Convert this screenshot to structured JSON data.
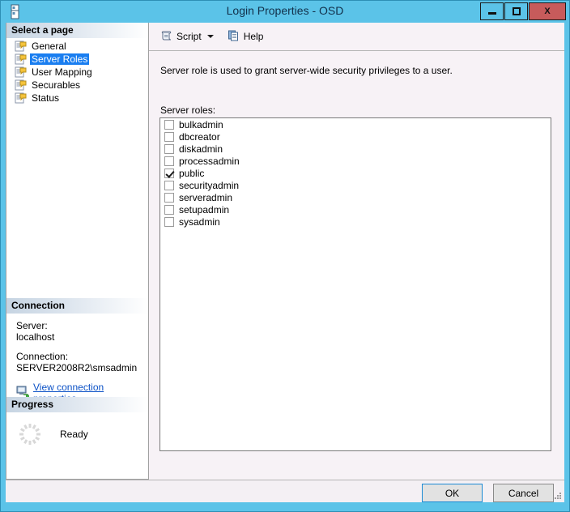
{
  "window": {
    "title": "Login Properties - OSD",
    "icon": "database-icon",
    "controls": {
      "minimize": "minimize-icon",
      "maximize": "maximize-icon",
      "close": "X"
    },
    "colors": {
      "titlebar": "#5bc3e8",
      "close_button": "#c75b5b",
      "selection": "#1a7ef0",
      "link": "#0b51c6",
      "pane_background": "#f7f2f6"
    }
  },
  "sidebar": {
    "header": "Select a page",
    "items": [
      {
        "label": "General",
        "selected": false
      },
      {
        "label": "Server Roles",
        "selected": true
      },
      {
        "label": "User Mapping",
        "selected": false
      },
      {
        "label": "Securables",
        "selected": false
      },
      {
        "label": "Status",
        "selected": false
      }
    ],
    "connection": {
      "header": "Connection",
      "server_label": "Server:",
      "server_value": "localhost",
      "connection_label": "Connection:",
      "connection_value": "SERVER2008R2\\smsadmin",
      "link": "View connection properties",
      "link_icon": "computer-network-icon"
    },
    "progress": {
      "header": "Progress",
      "status": "Ready",
      "spinner_icon": "spinner-icon"
    }
  },
  "toolbar": {
    "script_label": "Script",
    "script_icon": "script-scroll-icon",
    "dropdown_icon": "chevron-down-icon",
    "help_label": "Help",
    "help_icon": "help-document-icon"
  },
  "main": {
    "description": "Server role is used to grant server-wide security privileges to a user.",
    "roles_label": "Server roles:",
    "roles": [
      {
        "name": "bulkadmin",
        "checked": false
      },
      {
        "name": "dbcreator",
        "checked": false
      },
      {
        "name": "diskadmin",
        "checked": false
      },
      {
        "name": "processadmin",
        "checked": false
      },
      {
        "name": "public",
        "checked": true
      },
      {
        "name": "securityadmin",
        "checked": false
      },
      {
        "name": "serveradmin",
        "checked": false
      },
      {
        "name": "setupadmin",
        "checked": false
      },
      {
        "name": "sysadmin",
        "checked": false
      }
    ]
  },
  "footer": {
    "ok_label": "OK",
    "cancel_label": "Cancel"
  }
}
